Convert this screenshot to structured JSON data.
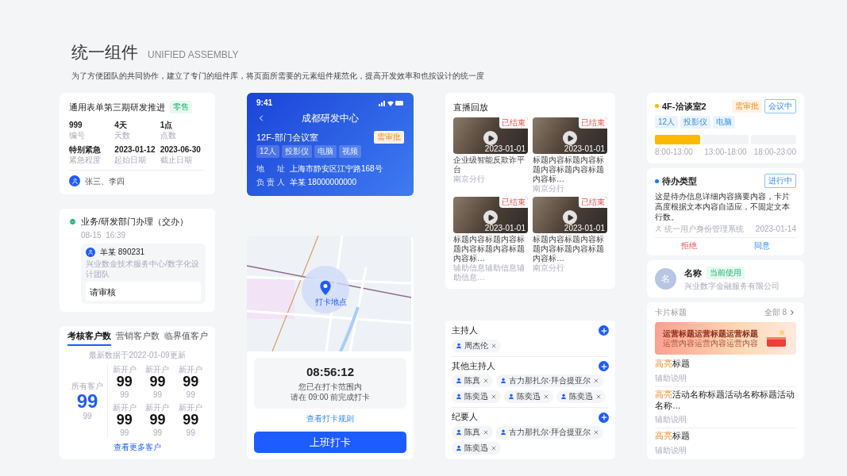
{
  "header": {
    "title": "统一组件",
    "subtitle": "UNIFIED ASSEMBLY",
    "description": "为了方便团队的共同协作，建立了专门的组件库，将页面所需要的元素组件规范化，提高开发效率和也按设计的统一度"
  },
  "project_card": {
    "title": "通用表单第三期研发推进",
    "tag": "零售",
    "fields": [
      {
        "value": "999",
        "label": "编号"
      },
      {
        "value": "4天",
        "label": "天数"
      },
      {
        "value": "1点",
        "label": "点数"
      },
      {
        "value": "特别紧急",
        "label": "紧急程度"
      },
      {
        "value": "2023-01-12",
        "label": "起始日期"
      },
      {
        "value": "2023-06-30",
        "label": "截止日期"
      }
    ],
    "members": "张三、李四"
  },
  "process_card": {
    "step": "业务/研发部门办理（交办）",
    "done": true,
    "time": "08-15  16:39",
    "person": "羊某 890231",
    "org": "兴业数金技术服务中心/数字化设计团队",
    "comment": "请审核"
  },
  "customer_card": {
    "tabs": [
      {
        "label": "考核客户数",
        "selected": true
      },
      {
        "label": "营销客户数",
        "selected": false
      },
      {
        "label": "临界值客户",
        "selected": false
      }
    ],
    "updated": "最新数据于2022-01-09更新",
    "total": {
      "label": "所有客户",
      "value": "99",
      "sub": "99"
    },
    "stats": [
      {
        "label": "新开户",
        "value": "99",
        "sub": "99"
      },
      {
        "label": "新开户",
        "value": "99",
        "sub": "99"
      },
      {
        "label": "新开户",
        "value": "99",
        "sub": "99"
      },
      {
        "label": "新开户",
        "value": "99",
        "sub": "99"
      },
      {
        "label": "新开户",
        "value": "99",
        "sub": "99"
      },
      {
        "label": "新开户",
        "value": "99",
        "sub": "99"
      }
    ],
    "link": "查看更多客户"
  },
  "room_card": {
    "status_time": "9:41",
    "nav_title": "成都研发中心",
    "room": "12F-部门会议室",
    "badge": "需审批",
    "tags": [
      "12人",
      "投影仪",
      "电脑",
      "视频"
    ],
    "info": [
      {
        "label": "地 址",
        "value": "上海市静安区江宁路168号"
      },
      {
        "label": "负责人",
        "value": "羊某 18000000000"
      }
    ]
  },
  "checkin_card": {
    "map_label": "打卡地点",
    "time": "08:56:12",
    "status": "您已在打卡范围内",
    "deadline": "请在 09:00 前完成打卡",
    "rule_link": "查看打卡规则",
    "button": "上班打卡"
  },
  "live_card": {
    "title": "直播回放",
    "videos": [
      {
        "status": "已结束",
        "date": "2023-01-01",
        "title": "企业级智能反欺诈平台",
        "sub": "南京分行"
      },
      {
        "status": "已结束",
        "date": "2023-01-01",
        "title": "标题内容标题内容标题内容标题内容标题内容标…",
        "sub": "南京分行"
      },
      {
        "status": "已结束",
        "date": "2023-01-01",
        "title": "标题内容标题内容标题内容标题内容标题内容标…",
        "sub": "辅助信息辅助信息辅助信息…"
      },
      {
        "status": "已结束",
        "date": "2023-01-01",
        "title": "标题内容标题内容标题内容标题内容标题内容标…",
        "sub": "南京分行"
      }
    ]
  },
  "participants_card": {
    "groups": [
      {
        "title": "主持人",
        "people": [
          "周杰伦"
        ]
      },
      {
        "title": "其他主持人",
        "people": [
          "陈真",
          "古力那扎尔·拜合提亚尔",
          "陈奕迅",
          "陈奕迅",
          "陈奕迅"
        ]
      },
      {
        "title": "纪要人",
        "people": [
          "陈真",
          "古力那扎尔·拜合提亚尔",
          "陈奕迅"
        ]
      }
    ]
  },
  "room_status_card": {
    "color": "#fcb900",
    "title": "4F-洽谈室2",
    "badges": [
      {
        "label": "需审批",
        "kind": "warning"
      },
      {
        "label": "会议中",
        "kind": "info"
      }
    ],
    "tags": [
      "12人",
      "投影仪",
      "电脑"
    ],
    "slots": [
      {
        "label": "8:00-13:00",
        "booked": true
      },
      {
        "label": "13:00-18:00",
        "booked": false
      },
      {
        "label": "18:00-23:00",
        "booked": false
      }
    ]
  },
  "todo_card": {
    "color": "#1677ff",
    "title": "待办类型",
    "status": "进行中",
    "body": "这是待办信息详细内容摘要内容，卡片高度根据文本内容自适应，不固定文本行数。",
    "source": "统一用户身份管理系统",
    "date": "2023-01-14",
    "actions": [
      {
        "label": "拒绝",
        "kind": "reject"
      },
      {
        "label": "同意",
        "kind": "approve"
      }
    ]
  },
  "profile_card": {
    "avatar": "名",
    "name": "名称",
    "tag": "当前使用",
    "company": "兴业数字金融服务有限公司"
  },
  "list_card": {
    "title": "卡片标题",
    "more": "全部 8",
    "banner": {
      "title": "运营标题运营标题运营标题",
      "text": "运营内容运营内容运营内容"
    },
    "items": [
      {
        "highlight": "高亮",
        "title": "标题",
        "sub": "辅助说明"
      },
      {
        "highlight": "高亮",
        "title": "活动名称标题活动名称标题活动名称…",
        "sub": "辅助说明"
      },
      {
        "highlight": "高亮",
        "title": "标题",
        "sub": "辅助说明"
      }
    ]
  }
}
